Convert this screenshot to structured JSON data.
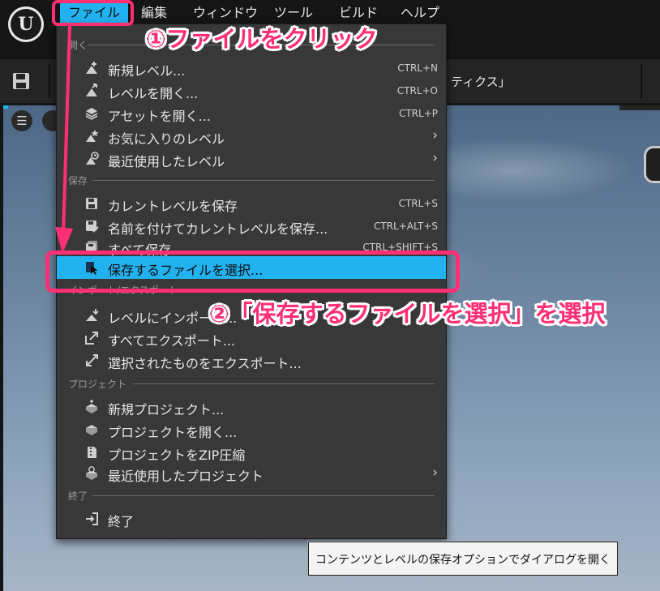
{
  "menubar": {
    "items": [
      "ファイル",
      "編集",
      "ウィンドウ",
      "ツール",
      "ビルド",
      "ヘルプ"
    ]
  },
  "toolbar": {
    "stats_text": "ティクス」"
  },
  "file_menu": {
    "sections": {
      "open": "開く",
      "save": "保存",
      "import_export": "インポート/エクスポート",
      "project": "プロジェクト",
      "exit": "終了"
    },
    "items": [
      {
        "label": "新規レベル...",
        "shortcut": "CTRL+N",
        "icon": "new-level-icon"
      },
      {
        "label": "レベルを開く...",
        "shortcut": "CTRL+O",
        "icon": "open-level-icon"
      },
      {
        "label": "アセットを開く...",
        "shortcut": "CTRL+P",
        "icon": "open-asset-icon"
      },
      {
        "label": "お気に入りのレベル",
        "shortcut": "",
        "icon": "favorite-levels-icon"
      },
      {
        "label": "最近使用したレベル",
        "shortcut": "",
        "icon": "recent-levels-icon"
      },
      {
        "label": "カレントレベルを保存",
        "shortcut": "CTRL+S",
        "icon": "save-icon"
      },
      {
        "label": "名前を付けてカレントレベルを保存...",
        "shortcut": "CTRL+ALT+S",
        "icon": "save-as-icon"
      },
      {
        "label": "すべて保存",
        "shortcut": "CTRL+SHIFT+S",
        "icon": "save-all-icon"
      },
      {
        "label": "保存するファイルを選択...",
        "shortcut": "",
        "icon": "choose-files-icon"
      },
      {
        "label": "レベルにインポート...",
        "shortcut": "",
        "icon": "import-icon"
      },
      {
        "label": "すべてエクスポート...",
        "shortcut": "",
        "icon": "export-all-icon"
      },
      {
        "label": "選択されたものをエクスポート...",
        "shortcut": "",
        "icon": "export-selected-icon"
      },
      {
        "label": "新規プロジェクト...",
        "shortcut": "",
        "icon": "new-project-icon"
      },
      {
        "label": "プロジェクトを開く...",
        "shortcut": "",
        "icon": "open-project-icon"
      },
      {
        "label": "プロジェクトをZIP圧縮",
        "shortcut": "",
        "icon": "zip-project-icon"
      },
      {
        "label": "最近使用したプロジェクト",
        "shortcut": "",
        "icon": "recent-projects-icon"
      },
      {
        "label": "終了",
        "shortcut": "",
        "icon": "exit-icon"
      }
    ],
    "submenu_arrow": "›"
  },
  "annotations": {
    "step1": "①ファイルをクリック",
    "step2": "②「保存するファイルを選択」を選択",
    "accent_color": "#ff2f74"
  },
  "tooltip": {
    "text": "コンテンツとレベルの保存オプションでダイアログを開く"
  },
  "colors": {
    "highlight": "#23b2f0",
    "menu_bg": "#383838",
    "app_bg": "#151515"
  }
}
